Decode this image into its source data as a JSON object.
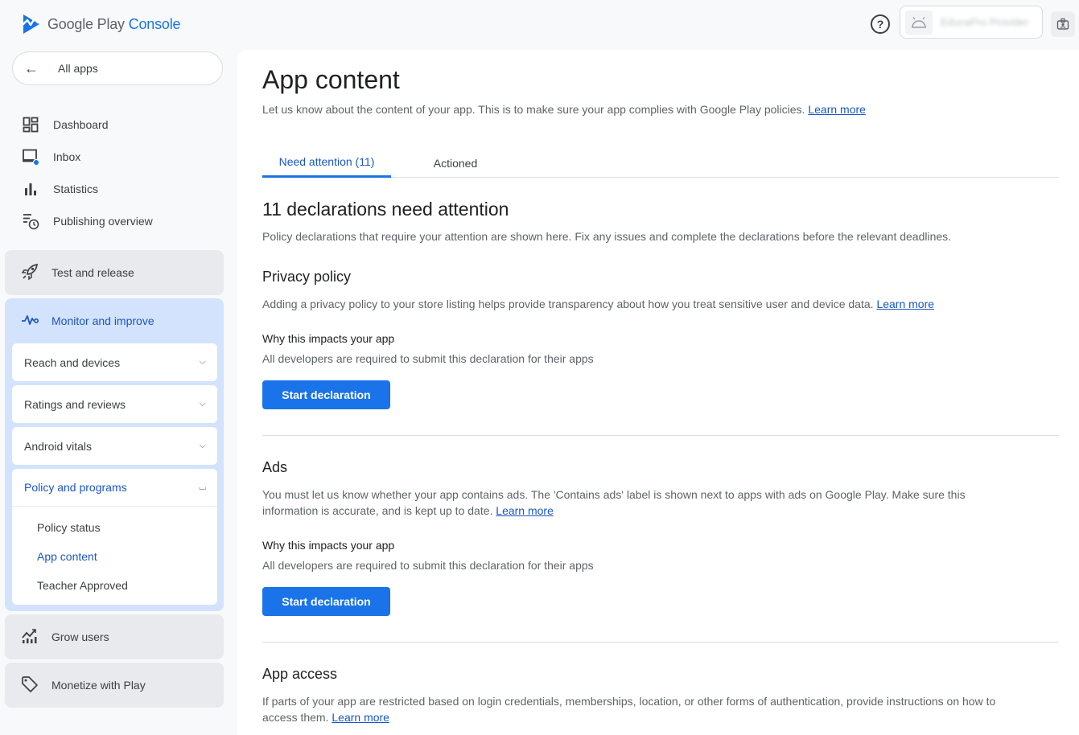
{
  "header": {
    "brand_google_play": "Google Play",
    "brand_console": "Console",
    "account_name": "EducaPro Provider"
  },
  "sidebar": {
    "all_apps": "All apps",
    "items": [
      {
        "label": "Dashboard"
      },
      {
        "label": "Inbox"
      },
      {
        "label": "Statistics"
      },
      {
        "label": "Publishing overview"
      }
    ],
    "sections": {
      "test_release": "Test and release",
      "monitor_improve": "Monitor and improve",
      "grow_users": "Grow users",
      "monetize": "Monetize with Play"
    },
    "monitor_sub": {
      "reach_devices": "Reach and devices",
      "ratings_reviews": "Ratings and reviews",
      "android_vitals": "Android vitals",
      "policy_programs": "Policy and programs",
      "policy_items": [
        "Policy status",
        "App content",
        "Teacher Approved"
      ]
    }
  },
  "main": {
    "title": "App content",
    "subtitle": "Let us know about the content of your app. This is to make sure your app complies with Google Play policies.",
    "learn_more": "Learn more",
    "tabs": [
      {
        "label": "Need attention (11)"
      },
      {
        "label": "Actioned"
      }
    ],
    "section_title": "11 declarations need attention",
    "section_desc": "Policy declarations that require your attention are shown here. Fix any issues and complete the declarations before the relevant deadlines.",
    "declarations": [
      {
        "title": "Privacy policy",
        "desc": "Adding a privacy policy to your store listing helps provide transparency about how you treat sensitive user and device data.",
        "why_title": "Why this impacts your app",
        "why_desc": "All developers are required to submit this declaration for their apps",
        "button": "Start declaration"
      },
      {
        "title": "Ads",
        "desc": "You must let us know whether your app contains ads. The 'Contains ads' label is shown next to apps with ads on Google Play. Make sure this information is accurate, and is kept up to date.",
        "why_title": "Why this impacts your app",
        "why_desc": "All developers are required to submit this declaration for their apps",
        "button": "Start declaration"
      },
      {
        "title": "App access",
        "desc": "If parts of your app are restricted based on login credentials, memberships, location, or other forms of authentication, provide instructions on how to access them."
      }
    ]
  }
}
